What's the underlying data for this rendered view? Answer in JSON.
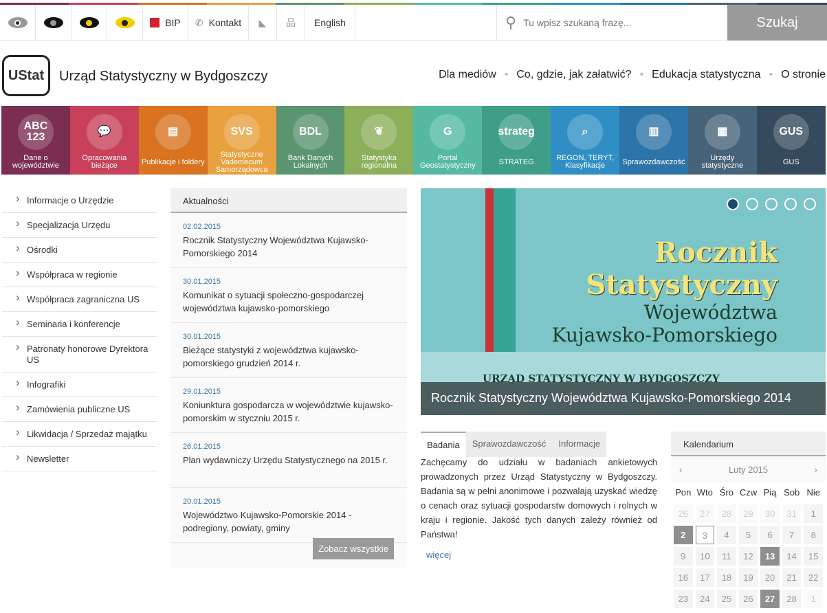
{
  "colors": {
    "stripe": [
      "#7b2e4f",
      "#c8405a",
      "#d9731f",
      "#e9a03e",
      "#5a9470",
      "#8cb05a",
      "#55b9a4",
      "#3e9e8a",
      "#2f8fc4",
      "#2d74a8",
      "#47637a",
      "#354a5c"
    ]
  },
  "topbar": {
    "contrast_icons": [
      "eye-gray",
      "eye-black",
      "eye-black-yellow",
      "eye-yellow"
    ],
    "bip": "BIP",
    "contact": "Kontakt",
    "english": "English",
    "search_placeholder": "Tu wpisz szukaną frazę...",
    "search_button": "Szukaj"
  },
  "header": {
    "logo": "UStat",
    "title": "Urząd Statystyczny w Bydgoszczy",
    "nav": [
      "Dla mediów",
      "Co, gdzie, jak załatwić?",
      "Edukacja statystyczna",
      "O stronie"
    ]
  },
  "tiles": [
    {
      "icon": "ABC 123",
      "label": "Dane o województwie",
      "color": "#7b2e4f"
    },
    {
      "icon": "chat-icon",
      "label": "Opracowania bieżące",
      "color": "#c8405a"
    },
    {
      "icon": "calendar-icon",
      "label": "Publikacje i foldery",
      "color": "#d9731f"
    },
    {
      "icon": "SVS",
      "label": "Statystyczne Vademecum Samorządowca",
      "color": "#e9a03e"
    },
    {
      "icon": "BDL",
      "label": "Bank Danych Lokalnych",
      "color": "#5a9470"
    },
    {
      "icon": "map-icon",
      "label": "Statystyka regionalna",
      "color": "#8cb05a"
    },
    {
      "icon": "G",
      "label": "Portal Geostatystyczny",
      "color": "#55b9a4"
    },
    {
      "icon": "strateg",
      "label": "STRATEG",
      "color": "#3e9e8a"
    },
    {
      "icon": "document-search-icon",
      "label": "REGON, TERYT, Klasyfikacje",
      "color": "#2f8fc4"
    },
    {
      "icon": "bar-chart-icon",
      "label": "Sprawozdawczość",
      "color": "#2d74a8"
    },
    {
      "icon": "building-icon",
      "label": "Urzędy statystyczne",
      "color": "#47637a"
    },
    {
      "icon": "GUS",
      "label": "GUS",
      "color": "#354a5c"
    }
  ],
  "sidebar": [
    "Informacje o Urzędzie",
    "Specjalizacja Urzędu",
    "Ośrodki",
    "Współpraca w regionie",
    "Współpraca zagraniczna US",
    "Seminaria i konferencje",
    "Patronaty honorowe Dyrektora US",
    "Infografiki",
    "Zamówienia publiczne US",
    "Likwidacja / Sprzedaż majątku",
    "Newsletter"
  ],
  "news": {
    "title": "Aktualności",
    "items": [
      {
        "date": "02.02.2015",
        "title": "Rocznik Statystyczny Województwa Kujawsko-Pomorskiego 2014"
      },
      {
        "date": "30.01.2015",
        "title": "Komunikat o sytuacji społeczno-gospodarczej województwa kujawsko-pomorskiego"
      },
      {
        "date": "30.01.2015",
        "title": "Bieżące statystyki z województwa kujawsko-pomorskiego grudzień 2014 r."
      },
      {
        "date": "29.01.2015",
        "title": "Koniunktura gospodarcza w województwie kujawsko-pomorskim w styczniu 2015 r."
      },
      {
        "date": "26.01.2015",
        "title": "Plan wydawniczy Urzędu Statystycznego na 2015 r."
      },
      {
        "date": "20.01.2015",
        "title": "Województwo Kujawsko-Pomorskie 2014 - podregiony, powiaty, gminy"
      }
    ],
    "more": "Zobacz wszystkie"
  },
  "banner": {
    "line1": "Rocznik",
    "line2": "Statystyczny",
    "line3": "Województwa",
    "line4": "Kujawsko-Pomorskiego",
    "line5": "URZĄD STATYSTYCZNY W BYDGOSZCZY",
    "caption": "Rocznik Statystyczny Województwa Kujawsko-Pomorskiego 2014",
    "slides": 5,
    "active_slide": 1
  },
  "tabs": {
    "items": [
      "Badania",
      "Sprawozdawczość",
      "Informacje"
    ],
    "active": "Badania",
    "text": "Zachęcamy do udziału w badaniach ankietowych prowadzonych przez Urząd Statystyczny w Bydgoszczy. Badania są w pełni anonimowe i pozwalają uzyskać wiedzę o cenach oraz sytuacji gospodarstw domowych i rolnych w kraju i regionie. Jakość tych danych zależy również od Państwa!",
    "more": "więcej"
  },
  "calendar": {
    "title": "Kalendarium",
    "month": "Luty 2015",
    "weekdays": [
      "Pon",
      "Wto",
      "Śro",
      "Czw",
      "Pią",
      "Sob",
      "Nie"
    ],
    "days": [
      "26",
      "27",
      "28",
      "29",
      "30",
      "31",
      "1",
      "2",
      "3",
      "4",
      "5",
      "6",
      "7",
      "8",
      "9",
      "10",
      "11",
      "12",
      "13",
      "14",
      "15",
      "16",
      "17",
      "18",
      "19",
      "20",
      "21",
      "22",
      "23",
      "24",
      "25",
      "26",
      "27",
      "28",
      "1"
    ],
    "other_month": [
      0,
      1,
      2,
      3,
      4,
      5,
      34
    ],
    "highlighted": [
      "2",
      "13",
      "27"
    ],
    "today": "3"
  }
}
